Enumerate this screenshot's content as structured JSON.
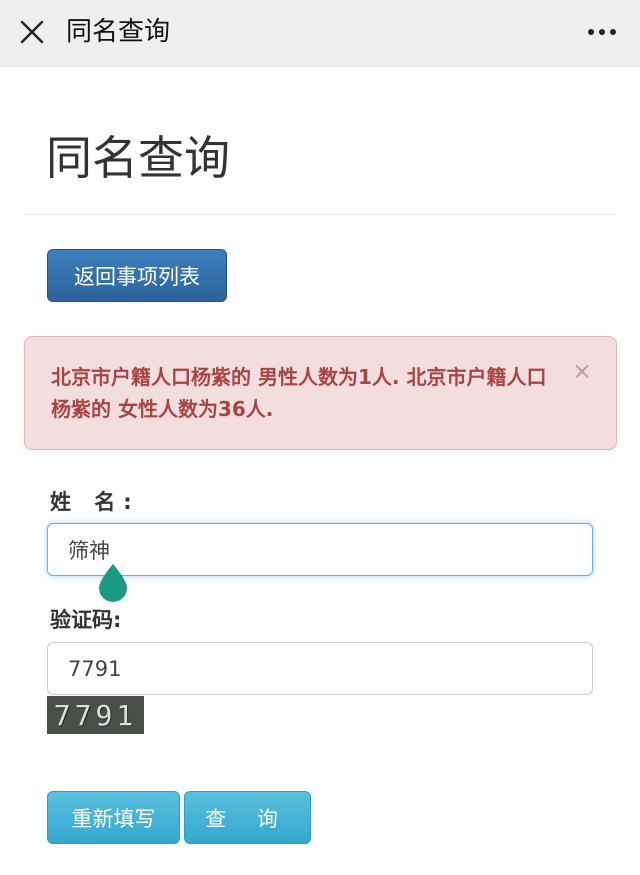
{
  "topbar": {
    "title": "同名查询"
  },
  "page": {
    "title": "同名查询"
  },
  "back_button": {
    "label": "返回事项列表"
  },
  "alert": {
    "message": "北京市户籍人口杨紫的 男性人数为1人. 北京市户籍人口杨紫的 女性人数为36人.",
    "close_symbol": "×"
  },
  "form": {
    "name_label": "姓 名:",
    "name_value": "筛神",
    "code_label": "验证码:",
    "code_value": "7791",
    "captcha_text": "7791"
  },
  "buttons": {
    "reset_label": "重新填写",
    "query_label": "查 询"
  },
  "colors": {
    "primary": "#337ab7",
    "info": "#5bc0de",
    "danger_text": "#a94442",
    "danger_bg": "#f2dede",
    "cursor_handle": "#1a9a82"
  },
  "icons": {
    "close": "close-icon",
    "more": "more-dots-icon",
    "cursor": "text-cursor-handle-icon"
  }
}
